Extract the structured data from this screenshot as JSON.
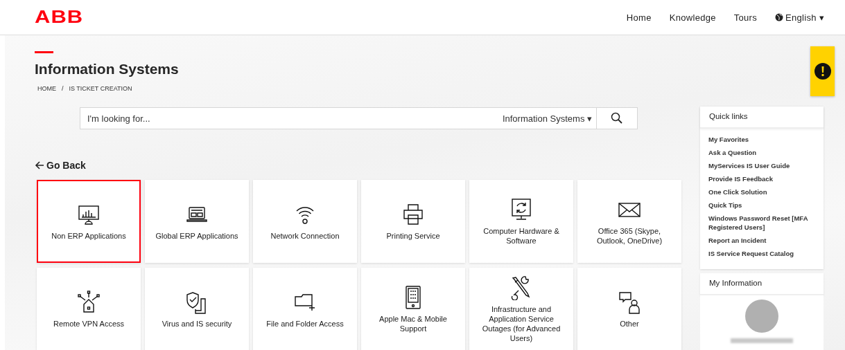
{
  "header": {
    "logo": "ABB",
    "nav": [
      "Home",
      "Knowledge",
      "Tours"
    ],
    "language": {
      "label": "English",
      "caret": "▾"
    }
  },
  "page": {
    "title": "Information Systems",
    "breadcrumb": [
      "HOME",
      "IS TICKET CREATION"
    ],
    "separator": "/"
  },
  "search": {
    "placeholder": "I'm looking for...",
    "scope": "Information Systems",
    "scope_caret": "▾"
  },
  "back": {
    "label": "Go Back"
  },
  "tiles": [
    {
      "label": "Non ERP Applications",
      "selected": true
    },
    {
      "label": "Global ERP Applications",
      "selected": false
    },
    {
      "label": "Network Connection",
      "selected": false
    },
    {
      "label": "Printing Service",
      "selected": false
    },
    {
      "label": "Computer Hardware & Software",
      "selected": false
    },
    {
      "label": "Office 365 (Skype, Outlook, OneDrive)",
      "selected": false
    },
    {
      "label": "Remote VPN Access",
      "selected": false
    },
    {
      "label": "Virus and IS security",
      "selected": false
    },
    {
      "label": "File and Folder Access",
      "selected": false
    },
    {
      "label": "Apple Mac & Mobile Support",
      "selected": false
    },
    {
      "label": "Infrastructure and Application Service Outages (for Advanced Users)",
      "selected": false
    },
    {
      "label": "Other",
      "selected": false
    }
  ],
  "quick_links": {
    "title": "Quick links",
    "items": [
      "My Favorites",
      "Ask a Question",
      "MyServices IS User Guide",
      "Provide IS Feedback",
      "One Click Solution",
      "Quick Tips",
      "Windows Password Reset [MFA Registered Users]",
      "Report an Incident",
      "IS Service Request Catalog"
    ]
  },
  "my_information": {
    "title": "My Information"
  }
}
